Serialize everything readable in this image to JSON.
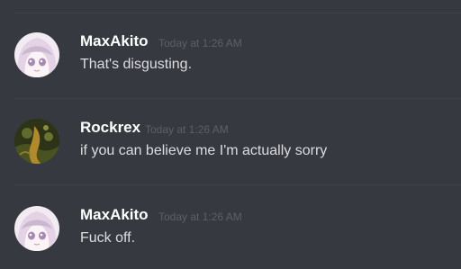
{
  "messages": [
    {
      "author": "MaxAkito",
      "timestamp": "Today at 1:26 AM",
      "content": "That's disgusting.",
      "avatar_icon": "anime-girl-avatar"
    },
    {
      "author": "Rockrex",
      "timestamp": "Today at 1:26 AM",
      "content": "if you can believe me I'm actually sorry",
      "avatar_icon": "dark-green-art-avatar"
    },
    {
      "author": "MaxAkito",
      "timestamp": "Today at 1:26 AM",
      "content": "Fuck off.",
      "avatar_icon": "anime-girl-avatar"
    }
  ],
  "colors": {
    "background": "#36393f",
    "username": "#ffffff",
    "message_text": "#dcddde",
    "timestamp": "#5d6066",
    "divider": "#3f4248"
  }
}
